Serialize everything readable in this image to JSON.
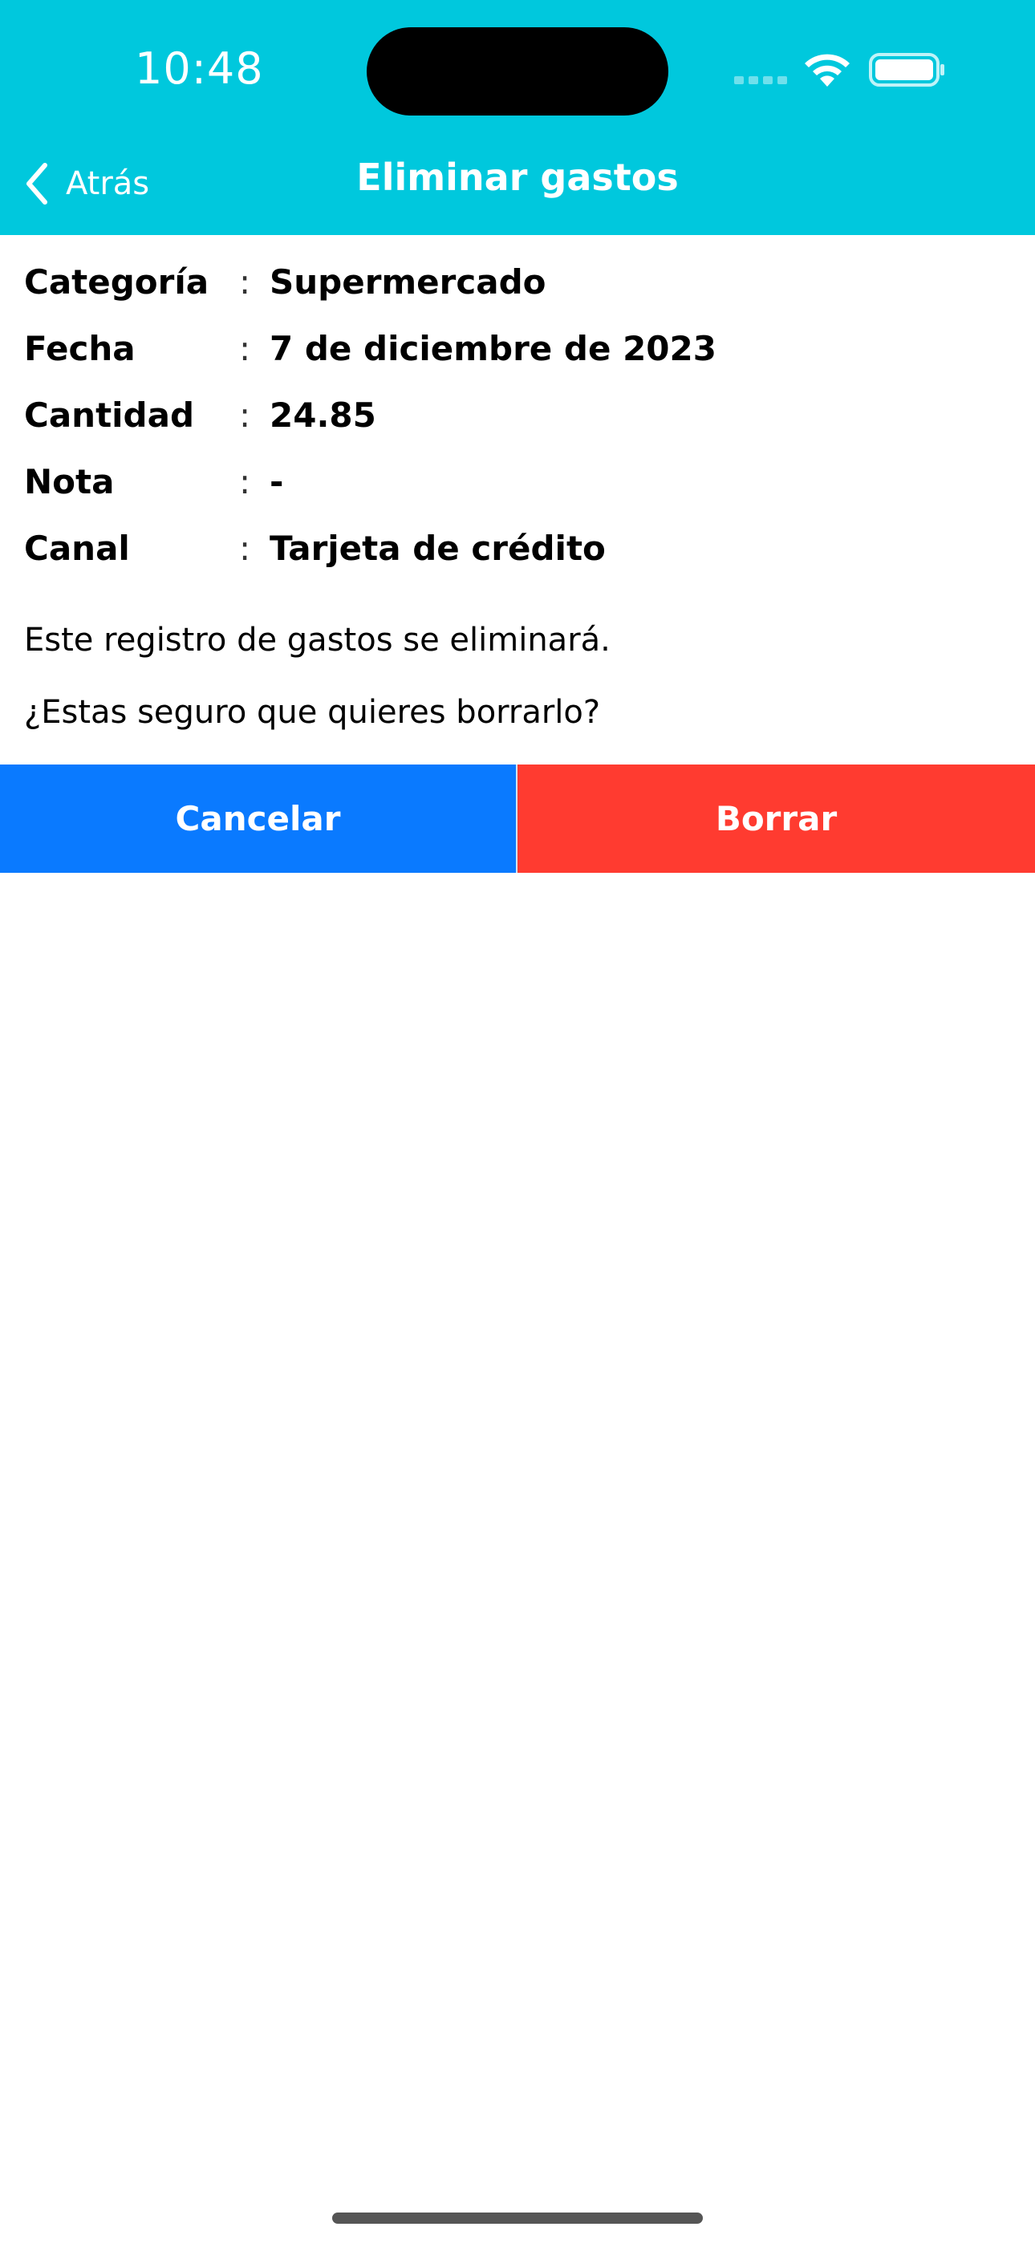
{
  "status_bar": {
    "time": "10:48"
  },
  "nav": {
    "back_label": "Atrás",
    "title": "Eliminar gastos"
  },
  "details": [
    {
      "label": "Categoría",
      "separator": ":",
      "value": "Supermercado"
    },
    {
      "label": "Fecha",
      "separator": ":",
      "value": "7 de diciembre de 2023"
    },
    {
      "label": "Cantidad",
      "separator": ":",
      "value": "24.85"
    },
    {
      "label": "Nota",
      "separator": ":",
      "value": "-"
    },
    {
      "label": "Canal",
      "separator": ":",
      "value": "Tarjeta de crédito"
    }
  ],
  "messages": {
    "warning": "Este registro de gastos se eliminará.",
    "question": "¿Estas seguro que quieres borrarlo?"
  },
  "buttons": {
    "cancel_label": "Cancelar",
    "delete_label": "Borrar"
  },
  "colors": {
    "header": "#00C8DD",
    "cancel": "#0A7AFF",
    "delete": "#FF3B30"
  },
  "icons": [
    "chevron-left-icon",
    "wifi-icon",
    "battery-icon",
    "cellular-signal-icon"
  ]
}
